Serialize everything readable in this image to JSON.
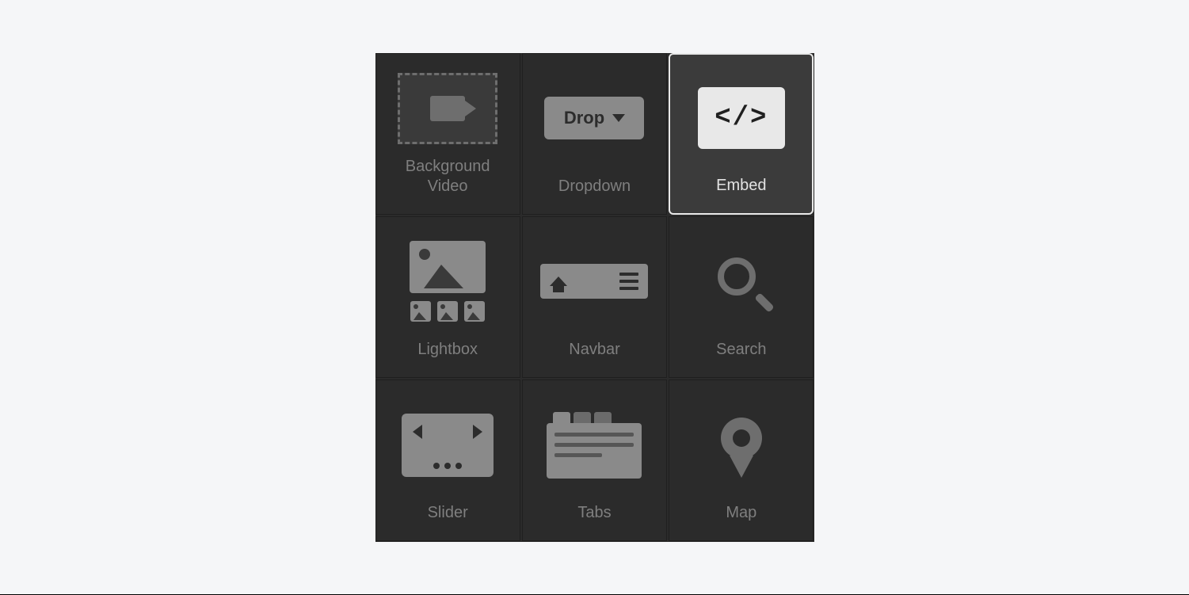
{
  "components": [
    {
      "label": "Background\nVideo",
      "selected": false
    },
    {
      "label": "Dropdown",
      "drop_text": "Drop",
      "selected": false
    },
    {
      "label": "Embed",
      "code_text": "</>",
      "selected": true
    },
    {
      "label": "Lightbox",
      "selected": false
    },
    {
      "label": "Navbar",
      "selected": false
    },
    {
      "label": "Search",
      "selected": false
    },
    {
      "label": "Slider",
      "selected": false
    },
    {
      "label": "Tabs",
      "selected": false
    },
    {
      "label": "Map",
      "selected": false
    }
  ]
}
